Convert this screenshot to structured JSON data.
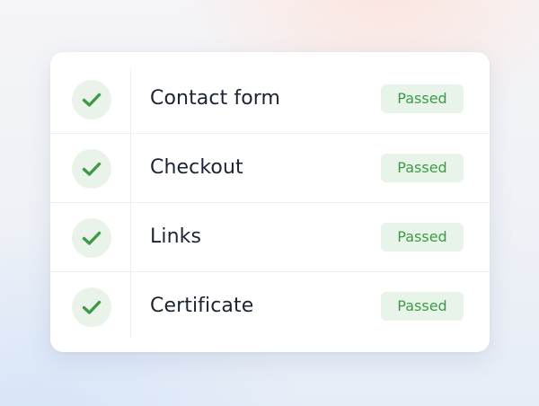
{
  "checks": [
    {
      "label": "Contact form",
      "status": "Passed",
      "icon": "check-icon"
    },
    {
      "label": "Checkout",
      "status": "Passed",
      "icon": "check-icon"
    },
    {
      "label": "Links",
      "status": "Passed",
      "icon": "check-icon"
    },
    {
      "label": "Certificate",
      "status": "Passed",
      "icon": "check-icon"
    }
  ],
  "colors": {
    "success_green": "#3f9a47",
    "badge_background": "#e8f4e9",
    "text": "#1c2433"
  }
}
